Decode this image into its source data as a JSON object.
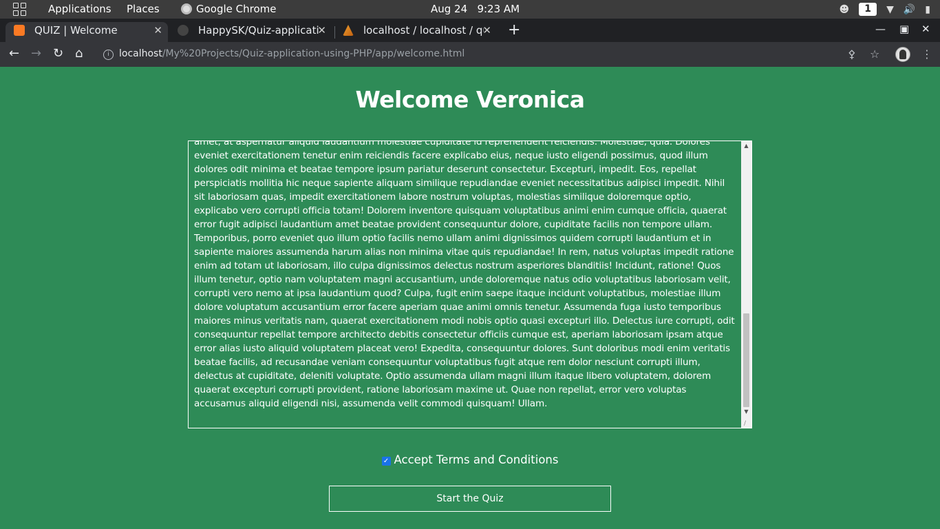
{
  "os_bar": {
    "applications": "Applications",
    "places": "Places",
    "app_name": "Google Chrome",
    "clock": "Aug 24   9:23 AM",
    "workspace": "1"
  },
  "tabs": [
    {
      "title": "QUIZ | Welcome",
      "active": true
    },
    {
      "title": "HappySK/Quiz-application-using-PHP",
      "active": false
    },
    {
      "title": "localhost / localhost / quiz",
      "active": false
    }
  ],
  "address_bar": {
    "host": "localhost",
    "path": "/My%20Projects/Quiz-application-using-PHP/app/welcome.html"
  },
  "page": {
    "title": "Welcome Veronica",
    "terms_text": "amet, at aspernatur aliquid laudantium molestiae cupiditate id reprehenderit reiciendis. Molestiae, quia. Dolores eveniet exercitationem tenetur enim reiciendis facere explicabo eius, neque iusto eligendi possimus, quod illum dolores odit minima et beatae tempore ipsum pariatur deserunt consectetur. Excepturi, impedit. Eos, repellat perspiciatis mollitia hic neque sapiente aliquam similique repudiandae eveniet necessitatibus adipisci impedit. Nihil sit laboriosam quas, impedit exercitationem labore nostrum voluptas, molestias similique doloremque optio, explicabo vero corrupti officia totam! Dolorem inventore quisquam voluptatibus animi enim cumque officia, quaerat error fugit adipisci laudantium amet beatae provident consequuntur dolore, cupiditate facilis non tempore ullam. Temporibus, porro eveniet quo illum optio facilis nemo ullam animi dignissimos quidem corrupti laudantium et in sapiente maiores assumenda harum alias non minima vitae quis repudiandae! In rem, natus voluptas impedit ratione enim ad totam ut laboriosam, illo culpa dignissimos delectus nostrum asperiores blanditiis! Incidunt, ratione! Quos illum tenetur, optio nam voluptatem magni accusantium, unde doloremque natus odio voluptatibus laboriosam velit, corrupti vero nemo at ipsa laudantium quod? Culpa, fugit enim saepe itaque incidunt voluptatibus, molestiae illum dolore voluptatum accusantium error facere aperiam quae animi omnis tenetur. Assumenda fuga iusto temporibus maiores minus veritatis nam, quaerat exercitationem modi nobis optio quasi excepturi illo. Delectus iure corrupti, odit consequuntur repellat tempore architecto debitis consectetur officiis cumque est, aperiam laboriosam ipsam atque error alias iusto aliquid voluptatem placeat vero! Expedita, consequuntur dolores. Sunt doloribus modi enim veritatis beatae facilis, ad recusandae veniam consequuntur voluptatibus fugit atque rem dolor nesciunt corrupti illum, delectus at cupiditate, deleniti voluptate. Optio assumenda ullam magni illum itaque libero voluptatem, dolorem quaerat excepturi corrupti provident, ratione laboriosam maxime ut. Quae non repellat, error vero voluptas accusamus aliquid eligendi nisi, assumenda velit commodi quisquam! Ullam.",
    "accept_label": "Accept Terms and Conditions",
    "accept_checked": true,
    "start_button": "Start the Quiz"
  },
  "colors": {
    "page_bg": "#2e8b57",
    "checkbox": "#1a73e8"
  }
}
